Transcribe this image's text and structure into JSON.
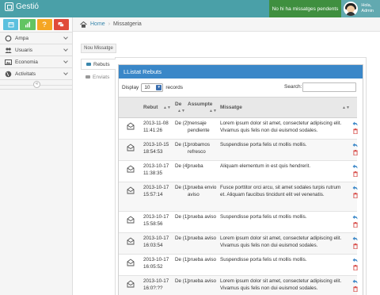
{
  "app": {
    "name": "Gestió"
  },
  "header": {
    "notification": "No hi ha missatges pendents",
    "greeting": "Hola,",
    "username": "Admin"
  },
  "colors": {
    "navbar": "#4aa0a8",
    "notify_bg": "#3f8f3f",
    "panel_head": "#3a87c8",
    "shortcuts": [
      "#5bc0de",
      "#62c462",
      "#f5a623",
      "#e04b3a"
    ]
  },
  "shortcuts": [
    {
      "icon": "calendar-icon"
    },
    {
      "icon": "bar-chart-icon"
    },
    {
      "icon": "question-icon"
    },
    {
      "icon": "chat-icon"
    }
  ],
  "sidebar": {
    "items": [
      {
        "label": "Ampa",
        "icon": "circle-icon"
      },
      {
        "label": "Usuaris",
        "icon": "users-icon"
      },
      {
        "label": "Economia",
        "icon": "picture-icon"
      },
      {
        "label": "Activitats",
        "icon": "globe-icon"
      }
    ],
    "collapse_glyph": "«"
  },
  "breadcrumb": {
    "home": "Home",
    "separator": "›",
    "current": "Missatgeria"
  },
  "tabs": {
    "new_message": "Nou Missatge",
    "inbox": "Rebuts",
    "sent": "Enviats"
  },
  "panel": {
    "title": "LListat Rebuts",
    "display_label": "Display",
    "page_size": "10",
    "records_label": "records",
    "search_label": "Search:"
  },
  "table": {
    "columns": {
      "date": "Rebut",
      "from": "De",
      "subject": "Assumpte",
      "message": "Missatge"
    },
    "rows": [
      {
        "date": "2013-11-08 11:41:26",
        "from": "De (2)",
        "subject": "mensaje pendiente",
        "message": "Lorem ipsum dolor sit amet, consectetur adipiscing elit. Vivamus quis felis non dui euismod sodales."
      },
      {
        "date": "2013-10-15 18:54:53",
        "from": "De (1)",
        "subject": "probamos refresco",
        "message": "Suspendisse porta felis ut mollis mollis."
      },
      {
        "date": "2013-10-17 11:38:35",
        "from": "De (4)",
        "subject": "prueba",
        "message": "Aliquam elementum in est quis hendrerit."
      },
      {
        "date": "2013-10-17 15:57:14",
        "from": "De (1)",
        "subject": "prueba envio aviso",
        "message": "Fusce porttitor orci arcu, sit amet sodales turpis rutrum et. Aliquam faucibus tincidunt elit vel venenatis."
      },
      {
        "date": "2013-10-17 15:58:56",
        "from": "De (1)",
        "subject": "prueba aviso",
        "message": "Suspendisse porta felis ut mollis mollis."
      },
      {
        "date": "2013-10-17 16:03:54",
        "from": "De (1)",
        "subject": "prueba aviso",
        "message": "Lorem ipsum dolor sit amet, consectetur adipiscing elit. Vivamus quis felis non dui euismod sodales."
      },
      {
        "date": "2013-10-17 16:05:52",
        "from": "De (1)",
        "subject": "prueba aviso",
        "message": "Suspendisse porta felis ut mollis mollis."
      },
      {
        "date": "2013-10-17 16:0?:??",
        "from": "De (1)",
        "subject": "prueba aviso",
        "message": "Lorem ipsum dolor sit amet, consectetur adipiscing elit. Vivamus quis felis non dui euismod sodales."
      }
    ]
  }
}
